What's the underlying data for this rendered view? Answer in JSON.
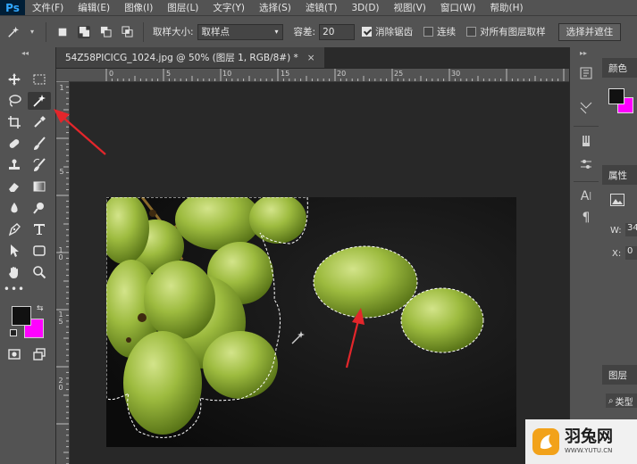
{
  "app": {
    "logo": "Ps"
  },
  "menu": [
    "文件(F)",
    "编辑(E)",
    "图像(I)",
    "图层(L)",
    "文字(Y)",
    "选择(S)",
    "滤镜(T)",
    "3D(D)",
    "视图(V)",
    "窗口(W)",
    "帮助(H)"
  ],
  "options": {
    "sample_size_label": "取样大小:",
    "sample_size_value": "取样点",
    "tolerance_label": "容差:",
    "tolerance_value": "20",
    "antialias_label": "消除锯齿",
    "antialias_checked": true,
    "contiguous_label": "连续",
    "contiguous_checked": false,
    "all_layers_label": "对所有图层取样",
    "all_layers_checked": false,
    "select_mask_button": "选择并遮住"
  },
  "document": {
    "tab_title": "54Z58PICICG_1024.jpg @ 50% (图层 1, RGB/8#) *",
    "close_glyph": "×"
  },
  "rulers": {
    "top": [
      "0",
      "5",
      "10",
      "15",
      "20",
      "25",
      "30"
    ],
    "left": [
      "1",
      "0",
      "5",
      "1 0",
      "1 5",
      "2 0"
    ]
  },
  "panels": {
    "color_label": "颜色",
    "properties_label": "属性",
    "w_label": "W:",
    "w_value": "34",
    "x_label": "X:",
    "x_value": "0",
    "layers_label": "图层",
    "layers_search_label": "类型",
    "foreground_color": "#111111",
    "background_color": "#ff00ff"
  },
  "watermark": {
    "name": "羽兔网",
    "url": "WWW.YUTU.CN"
  },
  "colors": {
    "annotation_arrow": "#e3262b",
    "grape": "#8fb03a",
    "accent": "#31a8ff"
  }
}
